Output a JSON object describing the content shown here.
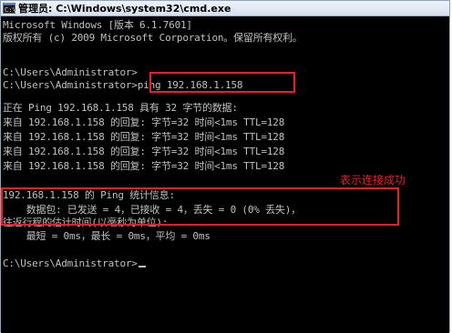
{
  "window": {
    "title": "管理员: C:\\Windows\\system32\\cmd.exe",
    "icon": "cmd-icon"
  },
  "console": {
    "lines": [
      "Microsoft Windows [版本 6.1.7601]",
      "版权所有 (c) 2009 Microsoft Corporation。保留所有权利。",
      "",
      "C:\\Users\\Administrator>",
      "C:\\Users\\Administrator>ping 192.168.1.158",
      "",
      "正在 Ping 192.168.1.158 具有 32 字节的数据:",
      "来自 192.168.1.158 的回复: 字节=32 时间<1ms TTL=128",
      "来自 192.168.1.158 的回复: 字节=32 时间<1ms TTL=128",
      "来自 192.168.1.158 的回复: 字节=32 时间<1ms TTL=128",
      "来自 192.168.1.158 的回复: 字节=32 时间<1ms TTL=128",
      "",
      "192.168.1.158 的 Ping 统计信息:",
      "    数据包: 已发送 = 4，已接收 = 4，丢失 = 0 (0% 丢失)，",
      "往返行程的估计时间(以毫秒为单位):",
      "    最短 = 0ms，最长 = 0ms，平均 = 0ms",
      "",
      "C:\\Users\\Administrator>"
    ]
  },
  "annotation": {
    "text": "表示连接成功",
    "color": "#e8202a"
  }
}
